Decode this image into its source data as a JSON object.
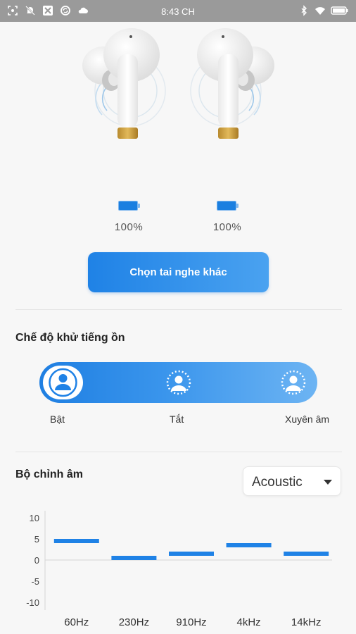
{
  "status_bar": {
    "time": "8:43 CH",
    "icons_left": [
      "screenshot-icon",
      "notification-muted-icon",
      "app-x-icon",
      "sync-icon",
      "cloud-icon"
    ],
    "icons_right": [
      "bluetooth-icon",
      "wifi-icon",
      "battery-icon"
    ]
  },
  "earbuds": {
    "left_battery": "100%",
    "right_battery": "100%",
    "left_level": 1.0,
    "right_level": 1.0
  },
  "choose_button": {
    "label": "Chọn tai nghe khác"
  },
  "noise_control": {
    "title": "Chế độ khử tiếng ồn",
    "modes": [
      {
        "label": "Bật",
        "icon": "person-icon",
        "selected": true
      },
      {
        "label": "Tắt",
        "icon": "person-dotted-icon",
        "selected": false
      },
      {
        "label": "Xuyên âm",
        "icon": "person-dotted-icon",
        "selected": false
      }
    ]
  },
  "equalizer": {
    "title": "Bộ chỉnh âm",
    "preset": "Acoustic"
  },
  "colors": {
    "accent": "#1f82e6",
    "accent_light": "#6db4f3",
    "status_bar": "#9a9a9a",
    "background": "#f7f7f7"
  },
  "chart_data": {
    "type": "bar",
    "categories": [
      "60Hz",
      "230Hz",
      "910Hz",
      "4kHz",
      "14kHz"
    ],
    "values": [
      4.5,
      0.5,
      1.5,
      3.5,
      1.5
    ],
    "yticks": [
      10,
      5,
      0,
      -5,
      -10
    ],
    "ylim": [
      -10,
      10
    ],
    "grid": false
  }
}
